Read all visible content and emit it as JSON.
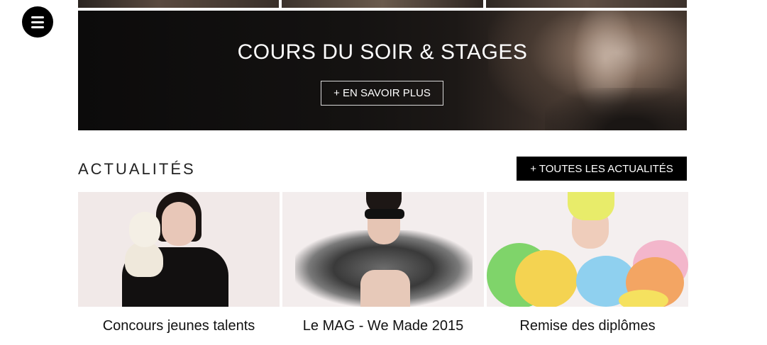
{
  "menu": {
    "icon": "hamburger-icon"
  },
  "hero": {
    "title": "COURS DU SOIR & STAGES",
    "button_label": "+ EN SAVOIR PLUS"
  },
  "news": {
    "section_title": "ACTUALITÉS",
    "all_button_label": "+ TOUTES LES ACTUALITÉS",
    "items": [
      {
        "caption": "Concours jeunes talents"
      },
      {
        "caption": "Le MAG - We Made 2015"
      },
      {
        "caption": "Remise des diplômes"
      }
    ]
  }
}
